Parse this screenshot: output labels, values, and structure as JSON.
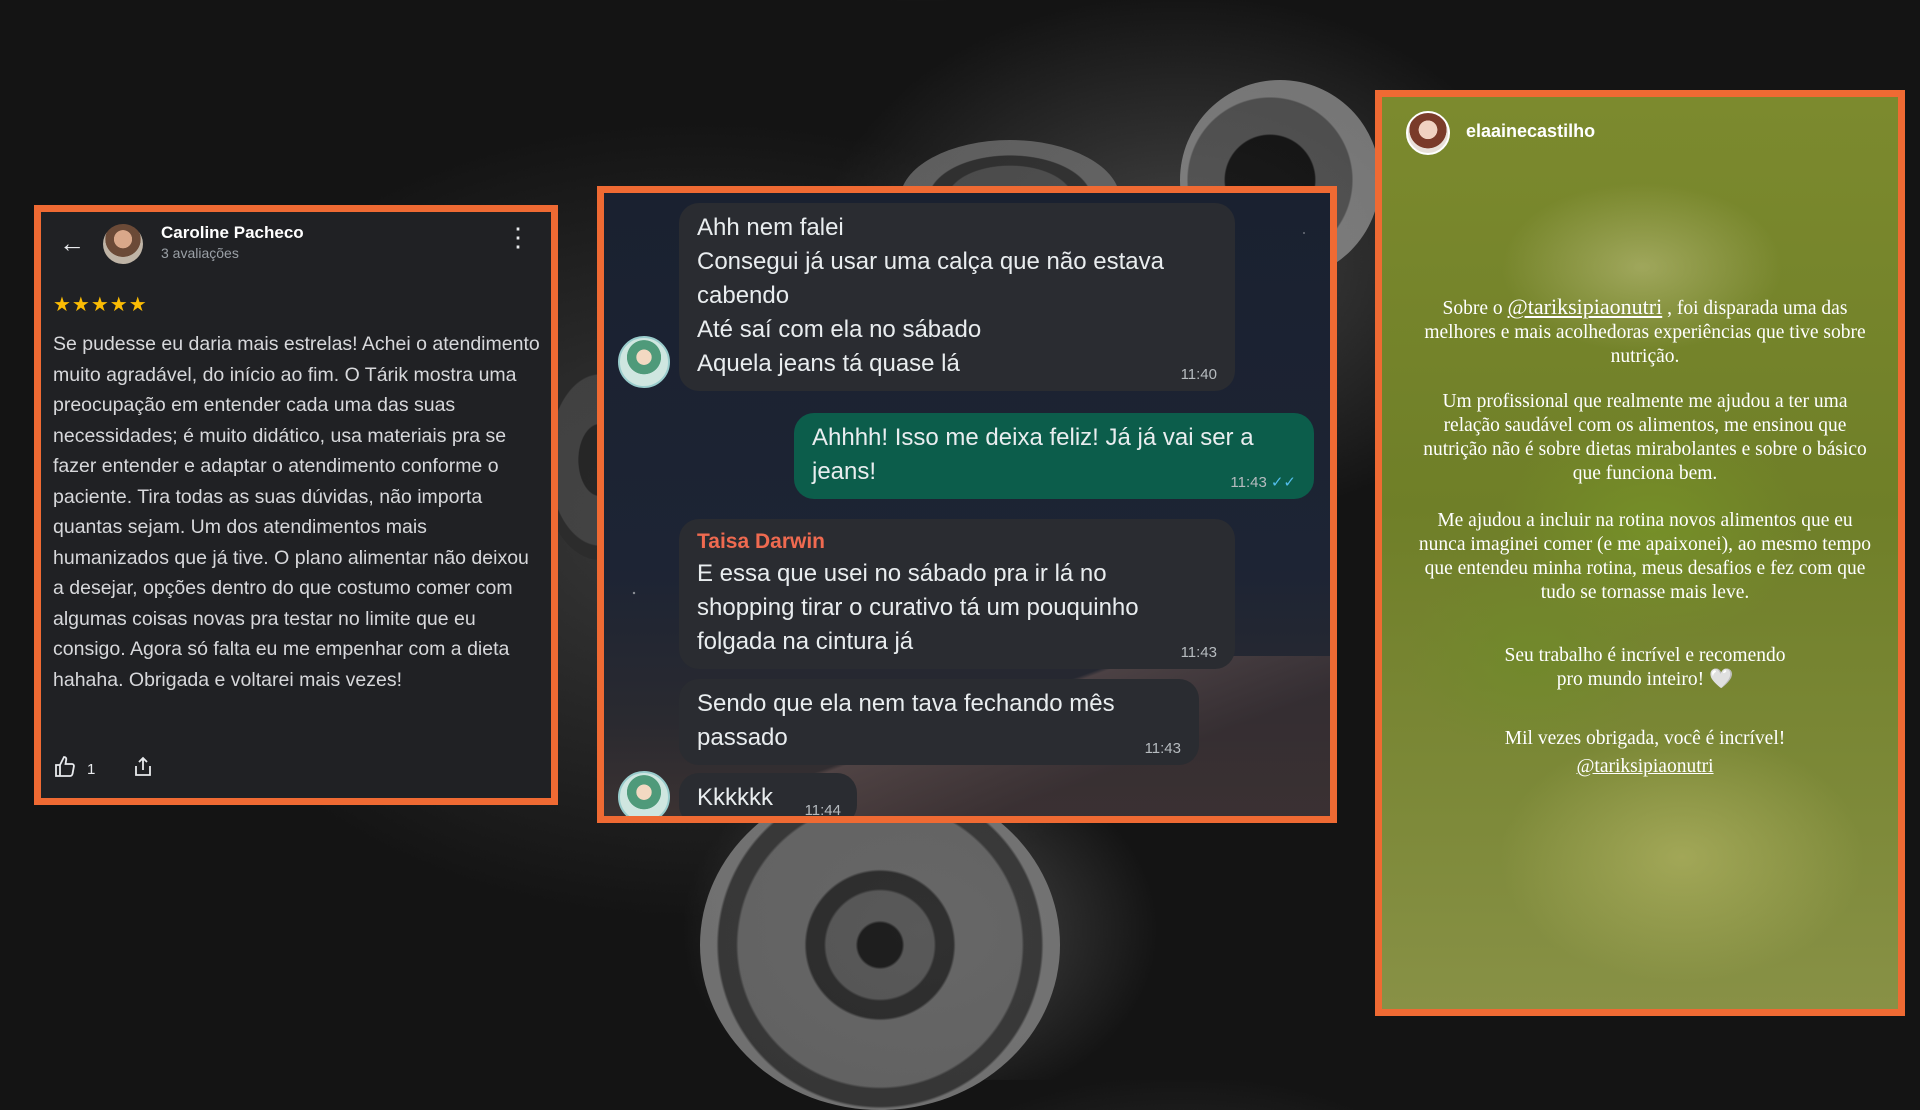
{
  "review": {
    "reviewer_name": "Caroline Pacheco",
    "reviewer_meta": "3 avaliações",
    "rating": 5,
    "stars_text": "★★★★★",
    "text": "Se pudesse eu daria mais estrelas! Achei o atendimento muito agradável, do início ao fim. O Tárik mostra uma preocupação em entender cada uma das suas necessidades; é muito didático, usa materiais pra se fazer entender e adaptar o atendimento conforme o paciente. Tira todas as suas dúvidas, não importa quantas sejam. Um dos atendimentos mais humanizados que já tive. O plano alimentar não deixou a desejar, opções dentro do que costumo comer com algumas coisas novas pra testar no limite que eu consigo. Agora só falta eu me empenhar com a dieta hahaha. Obrigada e voltarei mais vezes!",
    "likes": "1",
    "icons": {
      "back": "arrow-left-icon",
      "more": "more-vertical-icon",
      "like": "thumbs-up-icon",
      "share": "share-icon"
    }
  },
  "chat": {
    "messages": [
      {
        "dir": "in",
        "lines": [
          "Ahh nem falei",
          "Consegui já usar uma calça que não estava",
          "cabendo",
          "Até saí com ela no sábado",
          "Aquela jeans tá quase lá"
        ],
        "time": "11:40"
      },
      {
        "dir": "out",
        "lines": [
          "Ahhhh! Isso me deixa feliz! Já já vai ser a",
          "jeans!"
        ],
        "time": "11:43"
      },
      {
        "dir": "in",
        "sender": "Taisa Darwin",
        "lines": [
          "E essa que usei no sábado pra ir lá no",
          "shopping tirar o curativo tá um pouquinho",
          "folgada na cintura já"
        ],
        "time": "11:43"
      },
      {
        "dir": "in",
        "lines": [
          "Sendo que ela nem tava fechando mês",
          "passado"
        ],
        "time": "11:43"
      },
      {
        "dir": "in",
        "lines": [
          "Kkkkkk"
        ],
        "time": "11:44"
      }
    ],
    "colors": {
      "incoming": "#2a2c31",
      "outgoing": "#0c5d4b",
      "sender": "#ef6a50",
      "read_tick": "#53bdeb"
    }
  },
  "story": {
    "username": "elaainecastilho",
    "p1_before": "Sobre o",
    "p1_mention": "@tariksipiaonutri",
    "p1_after": ", foi disparada uma das melhores e mais acolhedoras experiências que tive sobre nutrição.",
    "p2": "Um profissional que realmente me ajudou a ter uma relação saudável com os alimentos, me ensinou que nutrição não é sobre dietas mirabolantes e sobre o básico que funciona bem.",
    "p3": "Me ajudou a incluir na rotina novos alimentos que eu nunca imaginei comer (e me apaixonei), ao mesmo tempo que entendeu minha rotina, meus desafios e fez com que tudo se tornasse mais leve.",
    "p4": "Seu trabalho é incrível e recomendo pro mundo inteiro! 🤍",
    "p5": "Mil vezes obrigada, você é incrível!",
    "p5_mention": "@tariksipiaonutri"
  },
  "theme": {
    "frame_color": "#ef6a33",
    "star_color": "#fbbc04"
  }
}
